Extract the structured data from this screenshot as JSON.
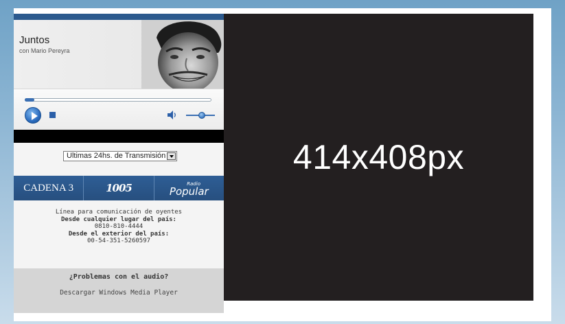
{
  "player": {
    "show_title": "Juntos",
    "show_host": "con Mario Pereyra",
    "seek_progress": 0.05,
    "volume_level": 0.55,
    "accent_color": "#2c5a8e",
    "play_icon": "play-icon",
    "stop_icon": "stop-icon",
    "volume_icon": "speaker-icon",
    "select": {
      "value": "Ultimas 24hs. de Transmisión",
      "icon": "dropdown-arrow-icon"
    }
  },
  "stations": [
    {
      "label": "CADENA 3"
    },
    {
      "label": "1005"
    },
    {
      "label": "Popular",
      "prefix": "Radio"
    }
  ],
  "contact": {
    "line1": "Línea para comunicación de oyentes",
    "line2": "Desde cualquier lugar del país:",
    "line3": "0810-810-4444",
    "line4": "Desde el exterior del país:",
    "line5": "00-54-351-5260597"
  },
  "help": {
    "title": "¿Problemas con el audio?",
    "link": "Descargar Windows Media Player"
  },
  "ad": {
    "label": "414x408px",
    "background": "#231f20"
  }
}
